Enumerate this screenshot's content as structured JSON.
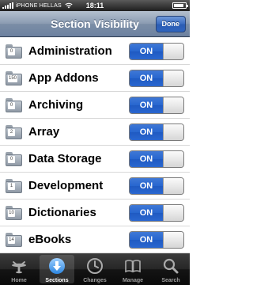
{
  "status_bar": {
    "carrier": "iPHONE HELLAS",
    "time": "18:11"
  },
  "nav": {
    "title": "Section Visibility",
    "done_label": "Done"
  },
  "sections": [
    {
      "name": "Administration",
      "count": "0",
      "toggle": "ON"
    },
    {
      "name": "App Addons",
      "count": "150",
      "toggle": "ON"
    },
    {
      "name": "Archiving",
      "count": "0",
      "toggle": "ON"
    },
    {
      "name": "Array",
      "count": "2",
      "toggle": "ON"
    },
    {
      "name": "Data Storage",
      "count": "0",
      "toggle": "ON"
    },
    {
      "name": "Development",
      "count": "1",
      "toggle": "ON"
    },
    {
      "name": "Dictionaries",
      "count": "10",
      "toggle": "ON"
    },
    {
      "name": "eBooks",
      "count": "14",
      "toggle": "ON"
    }
  ],
  "tabs": [
    {
      "label": "Home",
      "icon": "home-icon"
    },
    {
      "label": "Sections",
      "icon": "download-arrow-icon",
      "selected": true
    },
    {
      "label": "Changes",
      "icon": "clock-icon"
    },
    {
      "label": "Manage",
      "icon": "book-icon"
    },
    {
      "label": "Search",
      "icon": "magnifier-icon"
    }
  ],
  "colors": {
    "nav_bar": "#8a9bb1",
    "toggle_on": "#2766cf",
    "tab_bar": "#1a1a1a"
  }
}
